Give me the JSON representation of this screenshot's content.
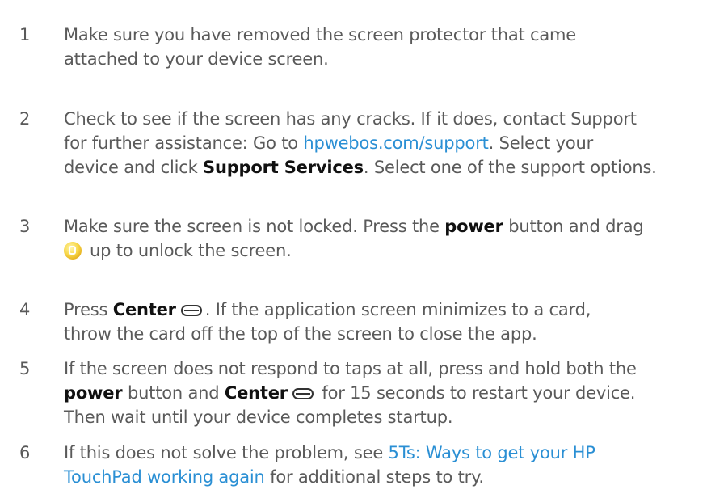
{
  "steps": [
    {
      "num": "1",
      "lines": [
        "Make sure you have removed the screen protector that came",
        "attached to your device screen."
      ]
    },
    {
      "num": "2",
      "line1": "Check to see if the screen has any cracks. If it does, contact Support",
      "line2_pre": "for further assistance: Go to ",
      "line2_link": "hpwebos.com/support",
      "line2_post": ". Select your",
      "line3_pre": "device and click ",
      "line3_bold": "Support Services",
      "line3_post": ". Select one of the support options."
    },
    {
      "num": "3",
      "line1_pre": "Make sure the screen is not locked. Press the ",
      "line1_bold": "power",
      "line1_post": " button and drag",
      "line2": "up to unlock the screen.",
      "icon": "unlock-icon"
    },
    {
      "num": "4",
      "line1_pre": "Press ",
      "line1_bold": "Center",
      "line1_post": ". If the application screen minimizes to a card,",
      "line2": "throw the card off the top of the screen to close the app.",
      "icon": "center-button-icon"
    },
    {
      "num": "5",
      "line1": "If the screen does not respond to taps at all, press and hold both the",
      "line2_bold1": "power",
      "line2_mid": " button and ",
      "line2_bold2": "Center",
      "line2_post": " for 15 seconds to restart your device.",
      "line3": "Then wait until your device completes startup.",
      "icon": "center-button-icon"
    },
    {
      "num": "6",
      "line1_pre": "If this does not solve the problem, see ",
      "line1_link": "5Ts: Ways to get your HP",
      "line2_link": "TouchPad working again",
      "line2_post": " for additional steps to try."
    }
  ]
}
